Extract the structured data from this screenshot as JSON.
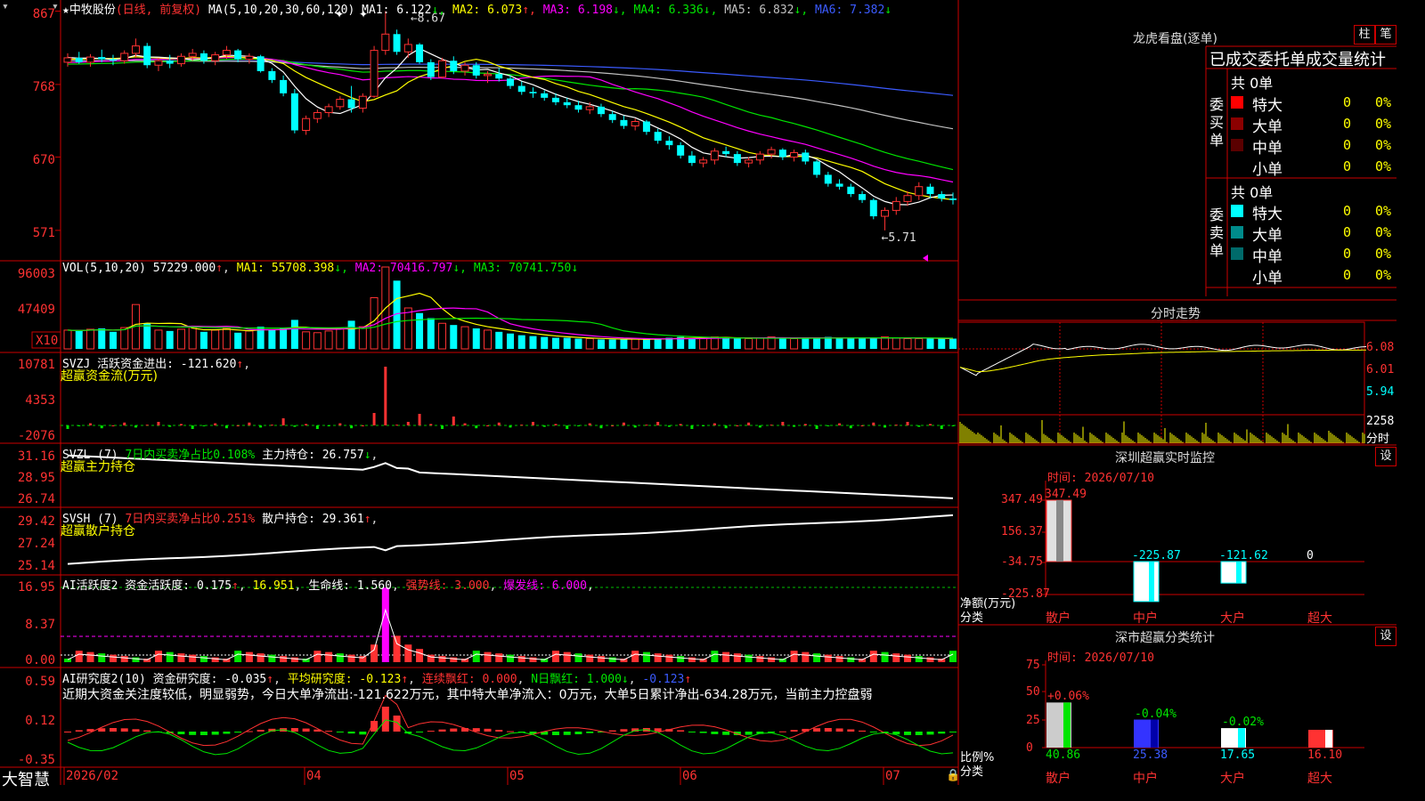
{
  "app": {
    "logo": "大智慧",
    "stock_title": "★中牧股份",
    "stock_mode": "(日线, 前复权)"
  },
  "colors": {
    "up": "#ff3232",
    "down": "#00ffff",
    "bg": "#000000",
    "grid": "#cc0000"
  },
  "kline": {
    "ma_header": "MA(5,10,20,30,60,120)",
    "ma_items": [
      {
        "label": "MA1: 6.122",
        "arrow": "↓",
        "color": "#ffffff"
      },
      {
        "label": "MA2: 6.073",
        "arrow": "↑",
        "color": "#ffff00"
      },
      {
        "label": "MA3: 6.198",
        "arrow": "↓",
        "color": "#ff00ff"
      },
      {
        "label": "MA4: 6.336",
        "arrow": "↓",
        "color": "#00e600"
      },
      {
        "label": "MA5: 6.832",
        "arrow": "↓",
        "color": "#c0c0c0"
      },
      {
        "label": "MA6: 7.382",
        "arrow": "↓",
        "color": "#3b5bff"
      }
    ],
    "y_ticks": [
      "867",
      "768",
      "670",
      "571"
    ],
    "high_label": "8.67",
    "low_label": "5.71"
  },
  "volume": {
    "header": "VOL(5,10,20)",
    "value": "57229.000",
    "items": [
      {
        "label": "MA1: 55708.398",
        "arrow": "↓",
        "color": "#ffff00"
      },
      {
        "label": "MA2: 70416.797",
        "arrow": "↓",
        "color": "#ff00ff"
      },
      {
        "label": "MA3: 70741.750",
        "arrow": "↓",
        "color": "#00e600"
      }
    ],
    "y_ticks": [
      "96003",
      "47409"
    ],
    "unit_label": "X10"
  },
  "svzj": {
    "header": "SVZJ  活跃资金进出: -121.620",
    "arrow": "↑",
    "sub": "超赢资金流(万元)",
    "y_ticks": [
      "10781",
      "4353",
      "-2076"
    ]
  },
  "svzl": {
    "header": "SVZL (7)",
    "pct": "7日内买卖净占比0.108%",
    "label": "主力持仓: 26.757",
    "arrow": "↓",
    "sub": "超赢主力持仓",
    "y_ticks": [
      "31.16",
      "28.95",
      "26.74"
    ]
  },
  "svsh": {
    "header": "SVSH (7)",
    "pct": "7日内买卖净占比0.251%",
    "label": "散户持仓: 29.361",
    "arrow": "↑",
    "sub": "超赢散户持仓",
    "y_ticks": [
      "29.42",
      "27.24",
      "25.14"
    ]
  },
  "ai_active": {
    "header": "AI活跃度2 资金活跃度: 0.175",
    "v2": "16.951",
    "life": "生命线: 1.560",
    "strong": "强势线: 3.000",
    "burst": "爆发线: 6.000",
    "y_ticks": [
      "16.95",
      "8.37",
      "0.00"
    ]
  },
  "ai_research": {
    "header": "AI研究度2(10) 资金研究度: -0.035",
    "avg": "平均研究度: -0.123",
    "lx": "连续飘红: 0.000",
    "n": "N日飘红: 1.000",
    "last": "-0.123",
    "comment": "近期大资金关注度较低，明显弱势，今日大单净流出:-121.622万元，其中特大单净流入：0万元，大单5日累计净出-634.28万元，当前主力控盘弱",
    "y_ticks": [
      "0.59",
      "0.12",
      "-0.35"
    ]
  },
  "x_axis": [
    "2026/02",
    "04",
    "05",
    "06",
    "07"
  ],
  "right_panel": {
    "lhkp_title": "龙虎看盘(逐单)",
    "btn_bar": "柱",
    "btn_pen": "笔",
    "tabs_label": "已成交委托单成交量统计",
    "buy": {
      "label": "委买单",
      "count": "共 0单",
      "rows": [
        {
          "name": "特大",
          "val": "0",
          "pct": "0%",
          "color": "#ff0000"
        },
        {
          "name": "大单",
          "val": "0",
          "pct": "0%",
          "color": "#8b0000"
        },
        {
          "name": "中单",
          "val": "0",
          "pct": "0%",
          "color": "#5a0000"
        },
        {
          "name": "小单",
          "val": "0",
          "pct": "0%",
          "color": ""
        }
      ]
    },
    "sell": {
      "label": "委卖单",
      "count": "共 0单",
      "rows": [
        {
          "name": "特大",
          "val": "0",
          "pct": "0%",
          "color": "#00ffff"
        },
        {
          "name": "大单",
          "val": "0",
          "pct": "0%",
          "color": "#008b8b"
        },
        {
          "name": "中单",
          "val": "0",
          "pct": "0%",
          "color": "#006a6a"
        },
        {
          "name": "小单",
          "val": "0",
          "pct": "0%",
          "color": ""
        }
      ]
    },
    "intraday": {
      "title": "分时走势",
      "y_ticks": [
        "6.08",
        "6.01",
        "5.94"
      ],
      "vol_value": "2258",
      "vol_unit": "分时"
    },
    "sz_monitor": {
      "title": "深圳超赢实时监控",
      "btn": "设",
      "time": "时间: 2026/07/10",
      "y_ticks": [
        "347.49",
        "156.37",
        "-34.75",
        "-225.87"
      ],
      "y_unit": "净额(万元)",
      "x_unit": "分类",
      "categories": [
        "散户",
        "中户",
        "大户",
        "超大"
      ],
      "values_text": [
        "347.49",
        "-225.87",
        "-121.62",
        "0"
      ]
    },
    "sz_classify": {
      "title": "深市超赢分类统计",
      "btn": "设",
      "time": "时间: 2026/07/10",
      "y_ticks": [
        "75",
        "50",
        "25",
        "0"
      ],
      "y_unit": "比例%",
      "x_unit": "分类",
      "categories": [
        "散户",
        "中户",
        "大户",
        "超大"
      ],
      "pct_change": [
        "+0.06%",
        "-0.04%",
        "-0.02%",
        ""
      ],
      "values_text": [
        "40.86",
        "25.38",
        "17.65",
        "16.10"
      ]
    }
  },
  "chart_data": [
    {
      "type": "candlestick",
      "title": "中牧股份 日线 前复权",
      "x": [
        "2026/02",
        "04",
        "05",
        "06",
        "07"
      ],
      "ylim": [
        5.71,
        8.67
      ],
      "candles_ohlc": [
        [
          7.98,
          8.1,
          7.92,
          8.04
        ],
        [
          8.04,
          8.12,
          7.96,
          7.98
        ],
        [
          7.98,
          8.09,
          7.92,
          8.05
        ],
        [
          8.05,
          8.15,
          7.98,
          8.02
        ],
        [
          8.02,
          8.08,
          7.94,
          8.0
        ],
        [
          8.0,
          8.14,
          7.96,
          8.1
        ],
        [
          8.1,
          8.3,
          8.04,
          8.2
        ],
        [
          8.2,
          8.24,
          7.9,
          7.94
        ],
        [
          7.94,
          8.04,
          7.86,
          8.0
        ],
        [
          8.0,
          8.08,
          7.9,
          7.96
        ],
        [
          7.96,
          8.1,
          7.92,
          8.06
        ],
        [
          8.06,
          8.16,
          8.0,
          8.1
        ],
        [
          8.1,
          8.14,
          7.96,
          8.0
        ],
        [
          8.0,
          8.12,
          7.94,
          8.08
        ],
        [
          8.08,
          8.2,
          8.02,
          8.14
        ],
        [
          8.14,
          8.16,
          7.98,
          8.02
        ],
        [
          8.02,
          8.1,
          7.96,
          8.06
        ],
        [
          8.06,
          8.08,
          7.84,
          7.86
        ],
        [
          7.86,
          7.9,
          7.7,
          7.74
        ],
        [
          7.74,
          7.8,
          7.52,
          7.56
        ],
        [
          7.56,
          7.62,
          7.02,
          7.06
        ],
        [
          7.06,
          7.26,
          7.0,
          7.22
        ],
        [
          7.22,
          7.34,
          7.16,
          7.3
        ],
        [
          7.3,
          7.42,
          7.24,
          7.38
        ],
        [
          7.38,
          7.52,
          7.34,
          7.48
        ],
        [
          7.48,
          7.66,
          7.3,
          7.36
        ],
        [
          7.36,
          7.56,
          7.3,
          7.52
        ],
        [
          7.52,
          8.2,
          7.5,
          8.14
        ],
        [
          8.14,
          8.67,
          8.08,
          8.36
        ],
        [
          8.36,
          8.42,
          8.08,
          8.12
        ],
        [
          8.12,
          8.3,
          8.04,
          8.22
        ],
        [
          8.22,
          8.24,
          7.96,
          7.98
        ],
        [
          7.98,
          8.02,
          7.74,
          7.78
        ],
        [
          7.78,
          8.04,
          7.76,
          8.0
        ],
        [
          8.0,
          8.06,
          7.82,
          7.86
        ],
        [
          7.86,
          7.98,
          7.8,
          7.94
        ],
        [
          7.94,
          7.98,
          7.76,
          7.8
        ],
        [
          7.8,
          7.86,
          7.7,
          7.82
        ],
        [
          7.82,
          7.9,
          7.72,
          7.76
        ],
        [
          7.76,
          7.8,
          7.62,
          7.66
        ],
        [
          7.66,
          7.72,
          7.54,
          7.58
        ],
        [
          7.58,
          7.64,
          7.5,
          7.56
        ],
        [
          7.56,
          7.6,
          7.46,
          7.5
        ],
        [
          7.5,
          7.56,
          7.4,
          7.44
        ],
        [
          7.44,
          7.5,
          7.36,
          7.4
        ],
        [
          7.4,
          7.46,
          7.3,
          7.34
        ],
        [
          7.34,
          7.44,
          7.28,
          7.38
        ],
        [
          7.38,
          7.42,
          7.24,
          7.28
        ],
        [
          7.28,
          7.32,
          7.16,
          7.2
        ],
        [
          7.2,
          7.26,
          7.08,
          7.12
        ],
        [
          7.12,
          7.22,
          7.06,
          7.18
        ],
        [
          7.18,
          7.2,
          7.0,
          7.04
        ],
        [
          7.04,
          7.08,
          6.88,
          6.92
        ],
        [
          6.92,
          6.98,
          6.8,
          6.86
        ],
        [
          6.86,
          6.9,
          6.68,
          6.72
        ],
        [
          6.72,
          6.78,
          6.58,
          6.62
        ],
        [
          6.62,
          6.7,
          6.56,
          6.66
        ],
        [
          6.66,
          6.82,
          6.6,
          6.78
        ],
        [
          6.78,
          6.84,
          6.7,
          6.74
        ],
        [
          6.74,
          6.78,
          6.58,
          6.62
        ],
        [
          6.62,
          6.7,
          6.56,
          6.66
        ],
        [
          6.66,
          6.78,
          6.6,
          6.74
        ],
        [
          6.74,
          6.84,
          6.68,
          6.8
        ],
        [
          6.8,
          6.82,
          6.66,
          6.7
        ],
        [
          6.7,
          6.8,
          6.64,
          6.76
        ],
        [
          6.76,
          6.8,
          6.6,
          6.64
        ],
        [
          6.64,
          6.66,
          6.42,
          6.46
        ],
        [
          6.46,
          6.5,
          6.3,
          6.34
        ],
        [
          6.34,
          6.4,
          6.26,
          6.3
        ],
        [
          6.3,
          6.34,
          6.16,
          6.2
        ],
        [
          6.2,
          6.24,
          6.08,
          6.12
        ],
        [
          6.12,
          6.14,
          5.86,
          5.9
        ],
        [
          5.9,
          6.02,
          5.71,
          5.98
        ],
        [
          5.98,
          6.16,
          5.92,
          6.1
        ],
        [
          6.1,
          6.24,
          6.04,
          6.18
        ],
        [
          6.18,
          6.36,
          6.12,
          6.3
        ],
        [
          6.3,
          6.34,
          6.14,
          6.2
        ],
        [
          6.2,
          6.24,
          6.1,
          6.14
        ],
        [
          6.14,
          6.22,
          6.06,
          6.12
        ]
      ]
    },
    {
      "type": "bar",
      "title": "VOL(5,10,20)",
      "ylim": [
        0,
        96003
      ],
      "series": [
        {
          "name": "VOL",
          "values": [
            22000,
            21000,
            23000,
            24000,
            20000,
            25000,
            52000,
            30000,
            22000,
            21000,
            23000,
            26000,
            20000,
            22000,
            24000,
            19000,
            21000,
            26000,
            22000,
            25000,
            34000,
            20000,
            19000,
            21000,
            24000,
            33000,
            26000,
            60000,
            96003,
            80000,
            48000,
            42000,
            36000,
            30000,
            28000,
            26000,
            24000,
            22000,
            20000,
            18000,
            16000,
            15000,
            14000,
            13000,
            13000,
            12000,
            12000,
            11000,
            11000,
            11000,
            12000,
            11000,
            12000,
            13000,
            14000,
            13000,
            13000,
            14000,
            13000,
            12000,
            12000,
            13000,
            14000,
            13000,
            12000,
            12000,
            13000,
            14000,
            13000,
            12000,
            12000,
            13000,
            14000,
            13000,
            12000,
            12000,
            12000,
            12000,
            12000
          ]
        }
      ]
    }
  ]
}
